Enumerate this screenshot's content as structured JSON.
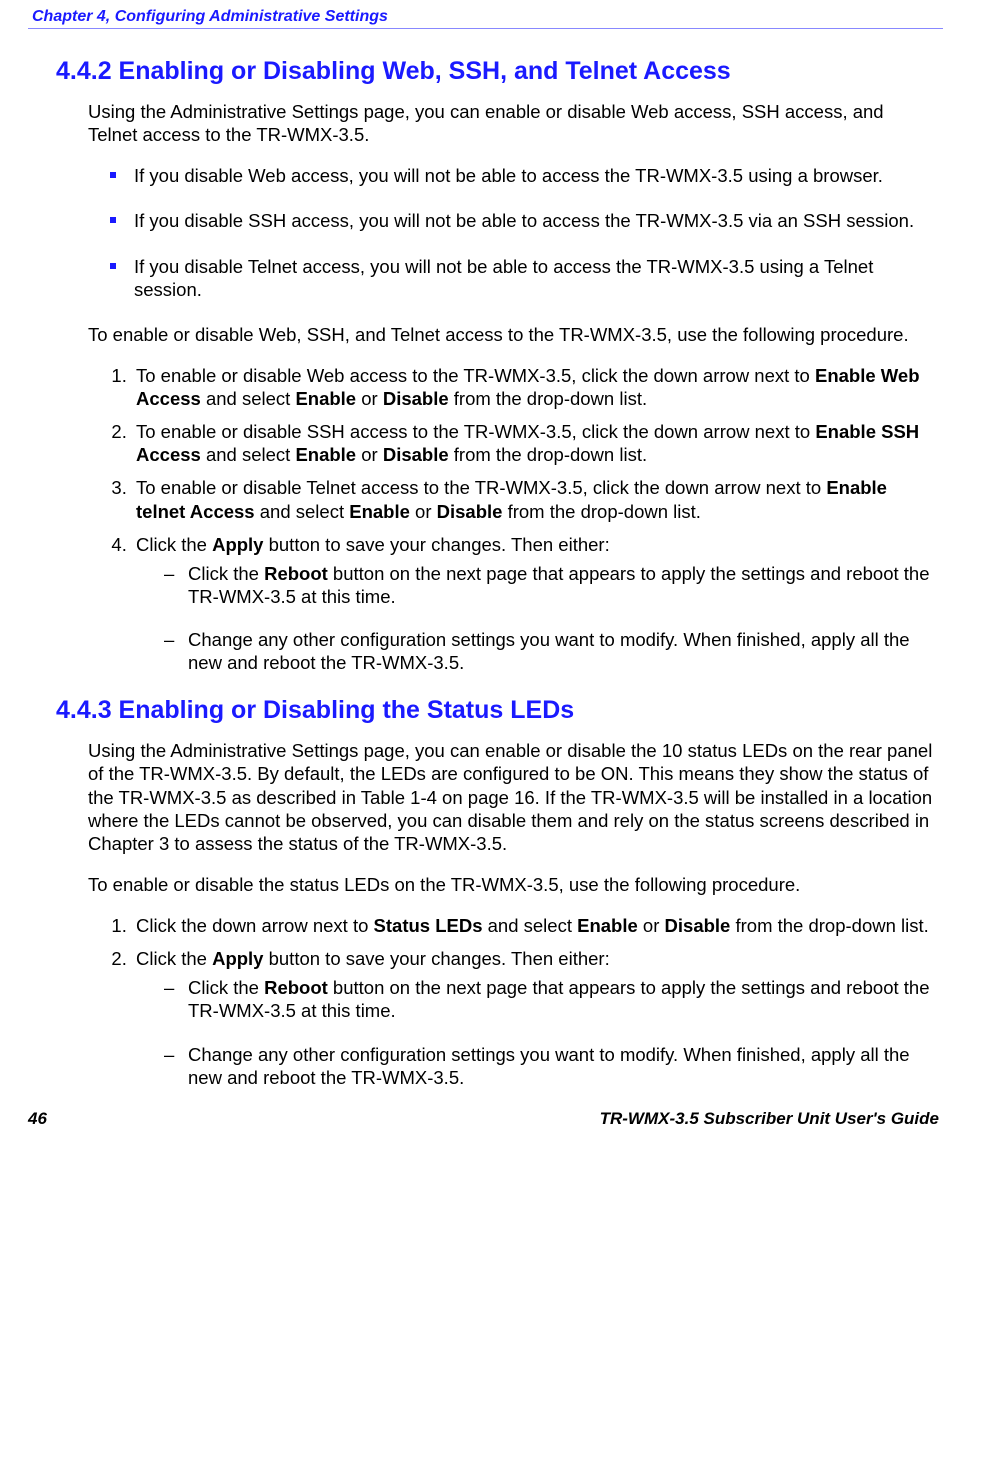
{
  "header": {
    "chapter_title": "Chapter 4, Configuring Administrative Settings"
  },
  "section442": {
    "heading": "4.4.2 Enabling or Disabling Web, SSH, and Telnet Access",
    "intro": "Using the Administrative Settings page, you can enable or disable Web access, SSH access, and Telnet access to the TR-WMX-3.5.",
    "bullets": [
      "If you disable Web access, you will not be able to access the TR-WMX-3.5 using a browser.",
      "If you disable SSH access, you will not be able to access the TR-WMX-3.5 via an SSH session.",
      "If you disable Telnet access, you will not be able to access the TR-WMX-3.5 using a Telnet session."
    ],
    "lead": "To enable or disable Web, SSH, and Telnet access to the TR-WMX-3.5, use the following procedure.",
    "steps": {
      "s1_pre": "To enable or disable Web access to the TR-WMX-3.5, click the down arrow next to ",
      "s1_b1": "Enable Web Access",
      "s1_mid": " and select ",
      "s1_b2": "Enable",
      "s1_or": " or ",
      "s1_b3": "Disable",
      "s1_post": " from the drop-down list.",
      "s2_pre": "To enable or disable SSH access to the TR-WMX-3.5, click the down arrow next to ",
      "s2_b1": "Enable SSH Access",
      "s3_pre": "To enable or disable Telnet access to the TR-WMX-3.5, click the down arrow next to ",
      "s3_b1": "Enable telnet Access",
      "s4_pre": "Click the ",
      "s4_b1": "Apply",
      "s4_post": " button to save your changes. Then either:",
      "d1_pre": "Click the ",
      "d1_b1": "Reboot",
      "d1_post": " button on the next page that appears to apply the settings and reboot the TR-WMX-3.5 at this time.",
      "d2": "Change any other configuration settings you want to modify. When finished, apply all the new and reboot the TR-WMX-3.5."
    }
  },
  "section443": {
    "heading": "4.4.3 Enabling or Disabling the Status LEDs",
    "intro": "Using the Administrative Settings page, you can enable or disable the 10 status LEDs on the rear panel of the TR-WMX-3.5. By default, the LEDs are configured to be ON. This means they show the status of the TR-WMX-3.5 as described in Table 1-4 on page 16. If the TR-WMX-3.5 will be installed in a location where the LEDs cannot be observed, you can disable them and rely on the status screens described in Chapter 3 to assess the status of the TR-WMX-3.5.",
    "lead": "To enable or disable the status LEDs on the TR-WMX-3.5, use the following procedure.",
    "steps": {
      "s1_pre": "Click the down arrow next to ",
      "s1_b1": "Status LEDs",
      "s1_mid": " and select ",
      "s1_b2": "Enable",
      "s1_or": " or ",
      "s1_b3": "Disable",
      "s1_post": " from the drop-down list.",
      "s2_pre": "Click the ",
      "s2_b1": "Apply",
      "s2_post": " button to save your changes. Then either:",
      "d1_pre": "Click the ",
      "d1_b1": "Reboot",
      "d1_post": " button on the next page that appears to apply the settings and reboot the TR-WMX-3.5 at this time.",
      "d2": "Change any other configuration settings you want to modify. When finished, apply all the new and reboot the TR-WMX-3.5."
    }
  },
  "footer": {
    "page_number": "46",
    "doc_title": "TR-WMX-3.5 Subscriber Unit User's Guide"
  }
}
